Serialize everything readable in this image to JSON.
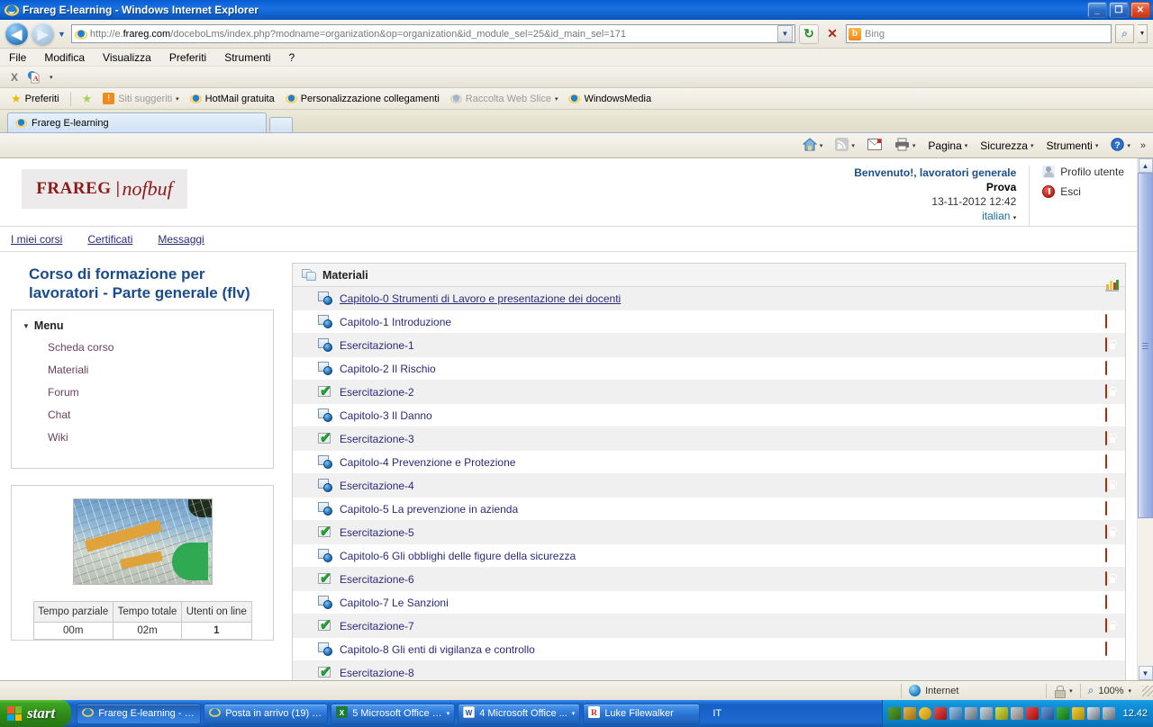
{
  "window": {
    "title": "Frareg E-learning - Windows Internet Explorer",
    "minimize": "_",
    "maximize": "❐",
    "close": "✕"
  },
  "address": {
    "url_prefix": "http://e.",
    "url_domain": "frareg.com",
    "url_path": "/doceboLms/index.php?modname=organization&op=organization&id_module_sel=25&id_main_sel=171",
    "dropdown": "▼",
    "refresh": "↻",
    "stop": "✕",
    "back": "◀",
    "forward": "▶"
  },
  "search": {
    "engine": "Bing",
    "placeholder": "Bing",
    "go": "⌕"
  },
  "menubar": [
    "File",
    "Modifica",
    "Visualizza",
    "Preferiti",
    "Strumenti",
    "?"
  ],
  "pdfbar": {
    "close_label": "X",
    "icon": "pdf-icon",
    "caret": "▾"
  },
  "favbar": {
    "favorites_label": "Preferiti",
    "items": [
      {
        "label": "Siti suggeriti",
        "dim": true,
        "caret": "▾"
      },
      {
        "label": "HotMail gratuita",
        "dim": false,
        "caret": ""
      },
      {
        "label": "Personalizzazione collegamenti",
        "dim": false,
        "caret": ""
      },
      {
        "label": "Raccolta Web Slice",
        "dim": true,
        "caret": "▾"
      },
      {
        "label": "WindowsMedia",
        "dim": false,
        "caret": ""
      }
    ]
  },
  "tabs": [
    {
      "label": "Frareg E-learning"
    }
  ],
  "commandbar": {
    "items": [
      {
        "label": "",
        "icon": "home-icon",
        "caret": "▾",
        "dim": false
      },
      {
        "label": "",
        "icon": "feeds-icon",
        "caret": "▾",
        "dim": true
      },
      {
        "label": "",
        "icon": "mail-icon",
        "caret": "",
        "dim": false
      },
      {
        "label": "",
        "icon": "print-icon",
        "caret": "▾",
        "dim": false
      },
      {
        "label": "Pagina",
        "icon": "",
        "caret": "▾",
        "dim": false
      },
      {
        "label": "Sicurezza",
        "icon": "",
        "caret": "▾",
        "dim": false
      },
      {
        "label": "Strumenti",
        "icon": "",
        "caret": "▾",
        "dim": false
      },
      {
        "label": "",
        "icon": "help-icon",
        "caret": "▾",
        "dim": false
      }
    ],
    "overflow": "»"
  },
  "page": {
    "logo": {
      "word": "FRAREG |",
      "script": "nofbuf"
    },
    "welcome": {
      "greeting": "Benvenuto!, lavoratori generale",
      "name": "Prova",
      "datetime": "13-11-2012 12:42",
      "language": "italian",
      "language_caret": "▾"
    },
    "user_actions": [
      {
        "label": "Profilo utente",
        "icon": "user-profile-icon"
      },
      {
        "label": "Esci",
        "icon": "logout-icon"
      }
    ],
    "mainnav": [
      "I miei corsi",
      "Certificati",
      "Messaggi"
    ],
    "course_title": "Corso di formazione per lavoratori - Parte generale (flv)",
    "menu": {
      "heading": "Menu",
      "caret": "▼",
      "items": [
        "Scheda corso",
        "Materiali",
        "Forum",
        "Chat",
        "Wiki"
      ]
    },
    "stats": {
      "headers": [
        "Tempo parziale",
        "Tempo totale",
        "Utenti on line"
      ],
      "values": [
        "00m",
        "02m",
        "1"
      ]
    },
    "materials": {
      "heading": "Materiali",
      "heading_icon": "folders-icon",
      "rows": [
        {
          "label": "Capitolo-0 Strumenti di Lavoro e presentazione dei docenti",
          "icon": "scorm-icon",
          "status": "chart-icon",
          "link": true
        },
        {
          "label": "Capitolo-1 Introduzione",
          "icon": "scorm-icon",
          "status": "lock-icon",
          "link": false
        },
        {
          "label": "Esercitazione-1",
          "icon": "scorm-icon",
          "status": "lock-icon",
          "link": false
        },
        {
          "label": "Capitolo-2 Il Rischio",
          "icon": "scorm-icon",
          "status": "lock-icon",
          "link": false
        },
        {
          "label": "Esercitazione-2",
          "icon": "test-icon",
          "status": "lock-icon",
          "link": false
        },
        {
          "label": "Capitolo-3 Il Danno",
          "icon": "scorm-icon",
          "status": "lock-icon",
          "link": false
        },
        {
          "label": "Esercitazione-3",
          "icon": "test-icon",
          "status": "lock-icon",
          "link": false
        },
        {
          "label": "Capitolo-4 Prevenzione e Protezione",
          "icon": "scorm-icon",
          "status": "lock-icon",
          "link": false
        },
        {
          "label": "Esercitazione-4",
          "icon": "scorm-icon",
          "status": "lock-icon",
          "link": false
        },
        {
          "label": "Capitolo-5 La prevenzione in azienda",
          "icon": "scorm-icon",
          "status": "lock-icon",
          "link": false
        },
        {
          "label": "Esercitazione-5",
          "icon": "test-icon",
          "status": "lock-icon",
          "link": false
        },
        {
          "label": "Capitolo-6 Gli obblighi delle figure della sicurezza",
          "icon": "scorm-icon",
          "status": "lock-icon",
          "link": false
        },
        {
          "label": "Esercitazione-6",
          "icon": "test-icon",
          "status": "lock-icon",
          "link": false
        },
        {
          "label": "Capitolo-7 Le Sanzioni",
          "icon": "scorm-icon",
          "status": "lock-icon",
          "link": false
        },
        {
          "label": "Esercitazione-7",
          "icon": "test-icon",
          "status": "lock-icon",
          "link": false
        },
        {
          "label": "Capitolo-8 Gli enti di vigilanza e controllo",
          "icon": "scorm-icon",
          "status": "lock-icon",
          "link": false
        },
        {
          "label": "Esercitazione-8",
          "icon": "test-icon",
          "status": "",
          "link": false
        }
      ]
    }
  },
  "statusbar": {
    "zone": "Internet",
    "zone_icon": "globe-icon",
    "protected_caret": "▾",
    "zoom": "100%",
    "zoom_caret": "▾"
  },
  "taskbar": {
    "start": "start",
    "tasks": [
      {
        "label": "Frareg E-learning - W...",
        "icon": "ie-icon",
        "caret": "",
        "active": true
      },
      {
        "label": "Posta in arrivo (19) - ...",
        "icon": "ie-icon",
        "caret": "",
        "active": false
      },
      {
        "label": "5 Microsoft Office E...",
        "icon": "excel-icon",
        "caret": "▾",
        "active": false
      },
      {
        "label": "4 Microsoft Office ...",
        "icon": "word-icon",
        "caret": "▾",
        "active": false
      },
      {
        "label": "Luke Filewalker",
        "icon": "avira-icon",
        "caret": "",
        "active": false
      }
    ],
    "ime": "IT",
    "clock": "12.42"
  },
  "colors": {
    "titlebar": "#0b61d6",
    "accent_link": "#2a2a7a",
    "brand": "#8d1a1a",
    "course_title": "#1a4b8c",
    "lock": "#ef5a22",
    "taskbar": "#175fc4"
  }
}
